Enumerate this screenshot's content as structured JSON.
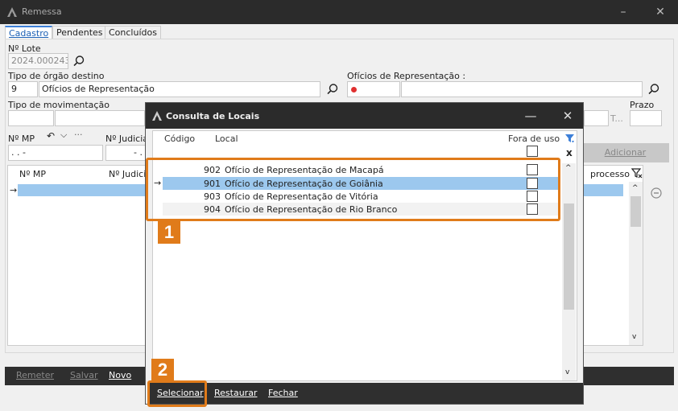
{
  "window": {
    "title": "Remessa",
    "min": "–",
    "close": "✕"
  },
  "tabs": [
    {
      "label": "Cadastro",
      "active": true
    },
    {
      "label": "Pendentes",
      "active": false
    },
    {
      "label": "Concluídos",
      "active": false
    }
  ],
  "form": {
    "lote_label": "Nº Lote",
    "lote_value": "2024.000243",
    "tipo_orgao_label": "Tipo de órgão destino",
    "tipo_orgao_code": "9",
    "tipo_orgao_name": "Ofícios de Representação",
    "oficios_label": "Ofícios de Representação :",
    "tipo_mov_label": "Tipo de movimentação",
    "prazo_label": "Prazo",
    "prazo_suffix": "T...",
    "nmp_label": "Nº MP",
    "nmp_value": ". .  -",
    "judicial_label": "Nº Judicia",
    "judicial_value": "- .",
    "adicionar_label": "Adicionar"
  },
  "main_grid": {
    "col_nmp": "Nº MP",
    "col_judicial": "Nº Judicia",
    "col_processo": "processo"
  },
  "bottom_bar": {
    "remeter": "Remeter",
    "salvar": "Salvar",
    "novo": "Novo"
  },
  "dialog": {
    "title": "Consulta de Locais",
    "min": "—",
    "close": "✕",
    "headers": {
      "codigo": "Código",
      "local": "Local",
      "fora_de_uso": "Fora de uso"
    },
    "rows": [
      {
        "code": "902",
        "name": "Ofício de Representação de Macapá",
        "selected": false
      },
      {
        "code": "901",
        "name": "Ofício de Representação de Goiânia",
        "selected": true
      },
      {
        "code": "903",
        "name": "Ofício de Representação de Vitória",
        "selected": false
      },
      {
        "code": "904",
        "name": "Ofício de Representação de Rio Branco",
        "selected": false
      }
    ],
    "buttons": {
      "selecionar": "Selecionar",
      "restaurar": "Restaurar",
      "fechar": "Fechar"
    }
  },
  "annotations": {
    "badge1": "1",
    "badge2": "2"
  },
  "colors": {
    "highlight": "#e07b1a",
    "selection": "#9cc8ee",
    "titlebar": "#2b2b2b"
  }
}
